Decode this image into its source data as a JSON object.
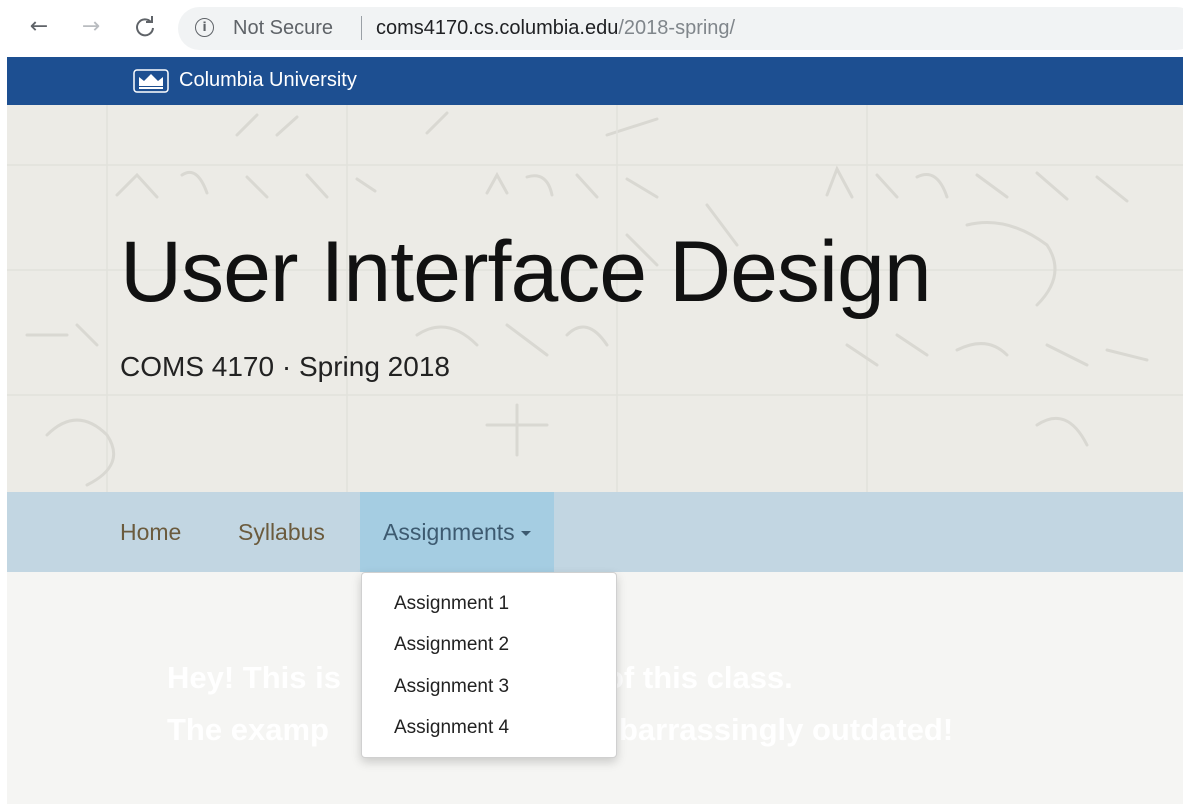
{
  "browser": {
    "back_icon": "←",
    "forward_icon": "→",
    "reload_icon": "C",
    "info_icon": "i",
    "security_label": "Not Secure",
    "url_host": "coms4170.cs.columbia.edu",
    "url_path": "/2018-spring/"
  },
  "university": {
    "name": "Columbia University",
    "bar_color": "#1d4f91"
  },
  "hero": {
    "title": "User Interface Design",
    "subtitle": "COMS 4170 · Spring 2018"
  },
  "navbar": {
    "items": [
      {
        "label": "Home"
      },
      {
        "label": "Syllabus"
      },
      {
        "label": "Assignments"
      }
    ],
    "active_color": "#a5cde2",
    "bar_color": "#c2d6e2"
  },
  "dropdown": {
    "items": [
      {
        "label": "Assignment 1"
      },
      {
        "label": "Assignment 2"
      },
      {
        "label": "Assignment 3"
      },
      {
        "label": "Assignment 4"
      }
    ]
  },
  "banner": {
    "line1_left": "Hey! This is",
    "line1_right": "of this class.",
    "line2_left": "The examp",
    "line2_right": "barrassingly outdated!"
  }
}
